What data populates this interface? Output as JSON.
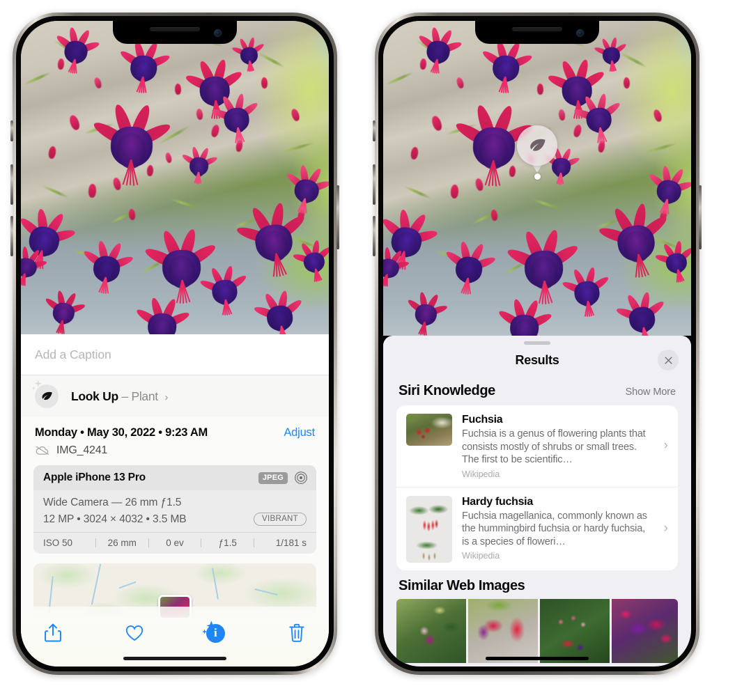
{
  "left_phone": {
    "caption_field": {
      "placeholder": "Add a Caption",
      "value": ""
    },
    "lookup_row": {
      "icon": "leaf-icon",
      "sparkle_icon": "sparkle-icon",
      "label": "Look Up",
      "dash": "–",
      "subject": "Plant",
      "chevron": "›"
    },
    "meta": {
      "date": "Monday • May 30, 2022 • 9:23 AM",
      "adjust_label": "Adjust",
      "cloud_icon": "icloud-slash-icon",
      "filename": "IMG_4241"
    },
    "exif": {
      "device": "Apple iPhone 13 Pro",
      "format_chip": "JPEG",
      "aperture_icon": "aperture-icon",
      "lens": "Wide Camera — 26 mm ƒ1.5",
      "size": "12 MP • 3024 × 4032 • 3.5 MB",
      "style_chip": "VIBRANT",
      "stats": [
        "ISO 50",
        "26 mm",
        "0 ev",
        "ƒ1.5",
        "1/181 s"
      ]
    },
    "map": {
      "name": "location-map-thumbnail"
    },
    "toolbar": [
      {
        "name": "share-button",
        "icon": "share-icon"
      },
      {
        "name": "favorite-button",
        "icon": "heart-icon"
      },
      {
        "name": "info-button",
        "icon": "info-circle-icon",
        "glyph": "i",
        "active": true
      },
      {
        "name": "delete-button",
        "icon": "trash-icon"
      }
    ],
    "accent_color": "#1f86f5"
  },
  "right_phone": {
    "visual_lookup_pin": {
      "icon": "leaf-icon",
      "name": "visual-lookup-pin"
    },
    "sheet": {
      "grabber": "drag-handle",
      "title": "Results",
      "close_icon": "close-icon"
    },
    "siri_knowledge": {
      "title": "Siri Knowledge",
      "show_more": "Show More",
      "items": [
        {
          "title": "Fuchsia",
          "description": "Fuchsia is a genus of flowering plants that consists mostly of shrubs or small trees. The first to be scientific…",
          "source": "Wikipedia",
          "chevron": "›"
        },
        {
          "title": "Hardy fuchsia",
          "description": "Fuchsia magellanica, commonly known as the hummingbird fuchsia or hardy fuchsia, is a species of floweri…",
          "source": "Wikipedia",
          "chevron": "›"
        }
      ]
    },
    "similar_web_images": {
      "title": "Similar Web Images",
      "thumbnails": [
        "web-image-1",
        "web-image-2",
        "web-image-3",
        "web-image-4"
      ]
    }
  }
}
